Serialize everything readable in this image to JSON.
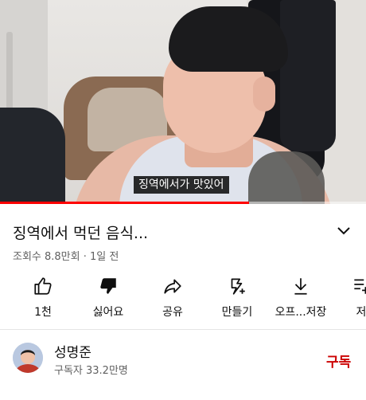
{
  "video": {
    "caption": "징역에서가 맛있어",
    "progress_percent": 68
  },
  "title": "징역에서 먹던 음식...",
  "meta": "조회수 8.8만회 · 1일 전",
  "actions": [
    {
      "icon": "thumb-up-icon",
      "label": "1천"
    },
    {
      "icon": "thumb-down-icon",
      "label": "싫어요"
    },
    {
      "icon": "share-icon",
      "label": "공유"
    },
    {
      "icon": "remix-icon",
      "label": "만들기"
    },
    {
      "icon": "download-icon",
      "label": "오프...저장"
    },
    {
      "icon": "save-icon",
      "label": "저"
    }
  ],
  "channel": {
    "name": "성명준",
    "subscribers": "구독자 33.2만명",
    "subscribe_label": "구독",
    "subscribe_color": "#cc0000"
  },
  "colors": {
    "progress": "#ff0000",
    "text_primary": "#0f0f0f",
    "text_secondary": "#606060"
  }
}
